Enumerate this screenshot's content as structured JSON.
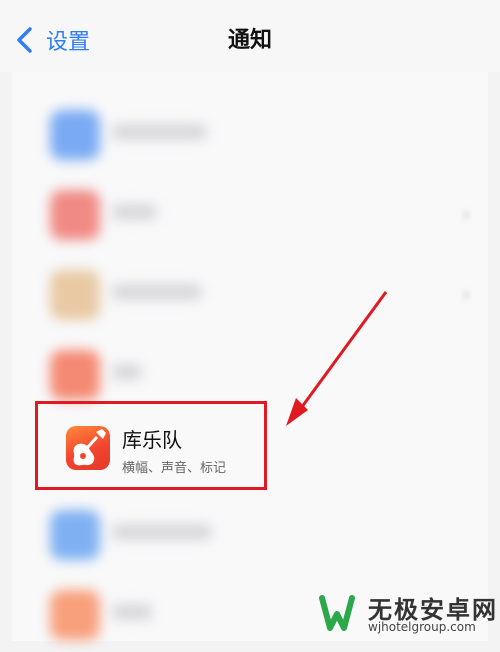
{
  "navbar": {
    "back_label": "设置",
    "title": "通知"
  },
  "highlighted_app": {
    "name": "库乐队",
    "subtitle": "横幅、声音、标记"
  },
  "watermark": {
    "brand": "无极安卓网",
    "url": "wjhotelgroup.com"
  },
  "colors": {
    "accent": "#2f7cf6",
    "highlight_box": "#e01a22",
    "blurred_icons": [
      "#79aaf3",
      "#f08a84",
      "#e8c9a4",
      "#f48a73",
      "#7fb1f2",
      "#f8a07c"
    ]
  }
}
